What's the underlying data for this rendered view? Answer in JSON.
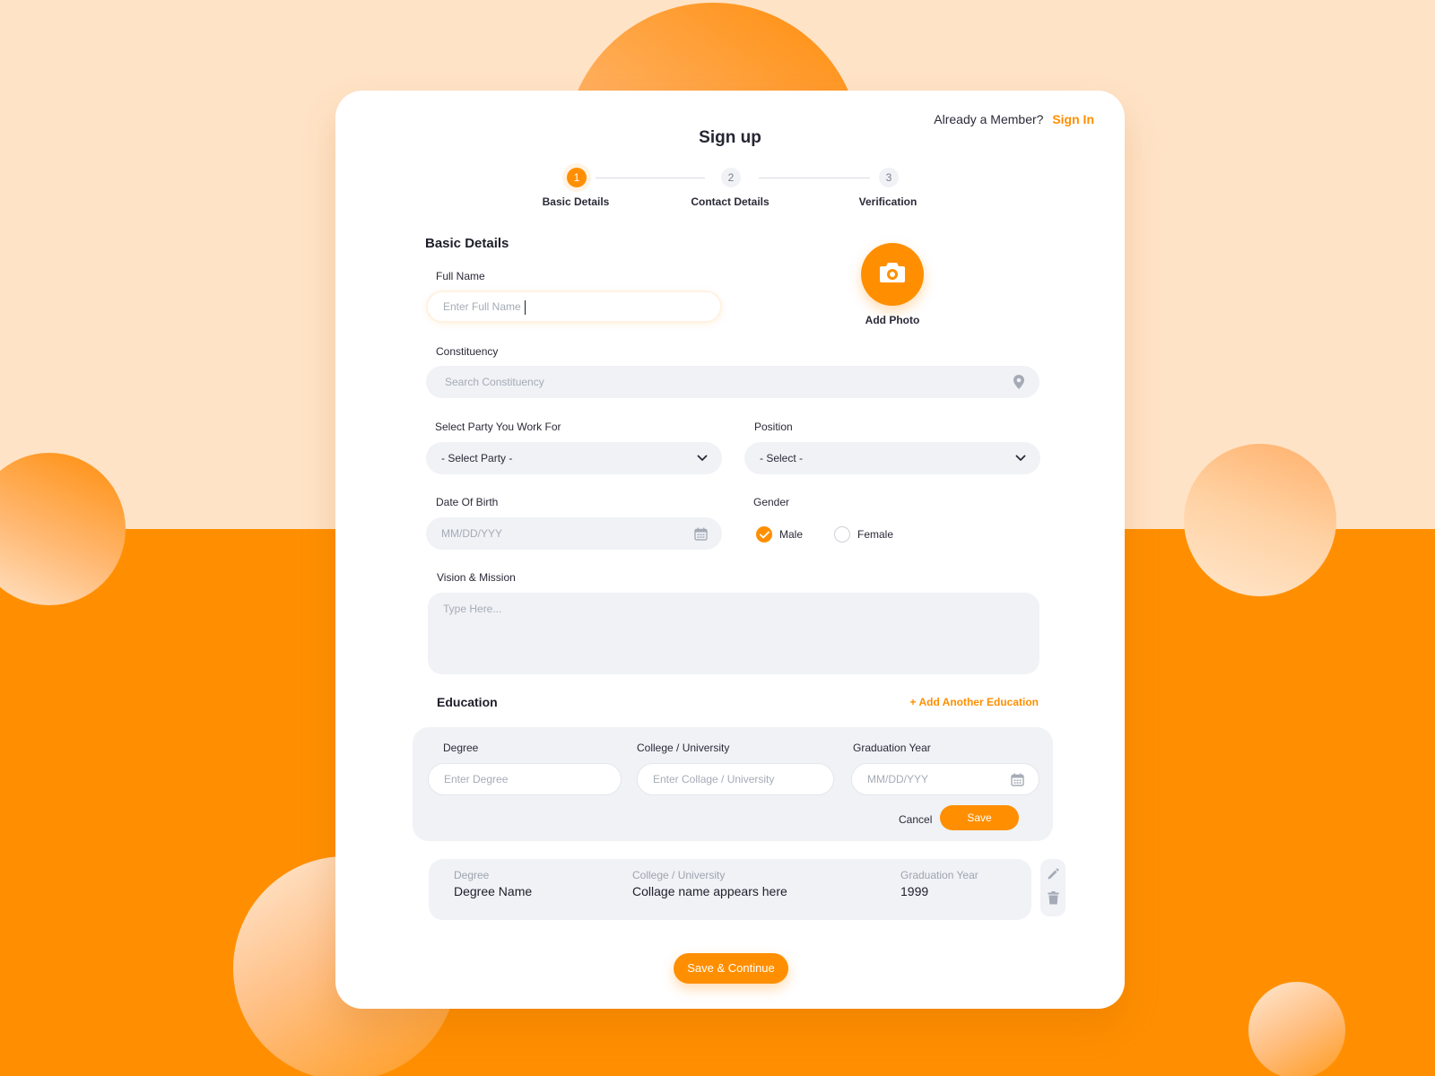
{
  "header": {
    "member_text": "Already a Member?",
    "sign_in_link": "Sign In",
    "title": "Sign up"
  },
  "stepper": {
    "steps": [
      {
        "number": "1",
        "label": "Basic Details",
        "active": true
      },
      {
        "number": "2",
        "label": "Contact Details",
        "active": false
      },
      {
        "number": "3",
        "label": "Verification",
        "active": false
      }
    ]
  },
  "basic": {
    "section_title": "Basic Details",
    "full_name": {
      "label": "Full Name",
      "placeholder": "Enter Full Name"
    },
    "photo": {
      "label": "Add Photo",
      "icon": "camera-icon"
    },
    "constituency": {
      "label": "Constituency",
      "placeholder": "Search Constituency",
      "icon": "location-pin-icon"
    },
    "party": {
      "label": "Select Party You Work For",
      "value": "- Select Party -",
      "icon": "chevron-down-icon"
    },
    "position": {
      "label": "Position",
      "value": "- Select -",
      "icon": "chevron-down-icon"
    },
    "dob": {
      "label": "Date Of Birth",
      "placeholder": "MM/DD/YYY",
      "icon": "calendar-icon"
    },
    "gender": {
      "label": "Gender",
      "options": [
        "Male",
        "Female"
      ],
      "selected": "Male"
    },
    "vision": {
      "label": "Vision & Mission",
      "placeholder": "Type Here..."
    }
  },
  "education": {
    "section_title": "Education",
    "add_link": "+ Add Another Education",
    "form": {
      "degree": {
        "label": "Degree",
        "placeholder": "Enter Degree"
      },
      "college": {
        "label": "College / University",
        "placeholder": "Enter Collage / University"
      },
      "year": {
        "label": "Graduation Year",
        "placeholder": "MM/DD/YYY"
      },
      "cancel": "Cancel",
      "save": "Save"
    },
    "entry": {
      "degree_caption": "Degree",
      "degree_value": "Degree Name",
      "college_caption": "College / University",
      "college_value": "Collage name appears here",
      "year_caption": "Graduation Year",
      "year_value": "1999"
    }
  },
  "footer": {
    "submit": "Save & Continue"
  },
  "colors": {
    "accent": "#ff8f00",
    "field_bg": "#f0f2f6",
    "page_top": "#ffe3c6"
  }
}
